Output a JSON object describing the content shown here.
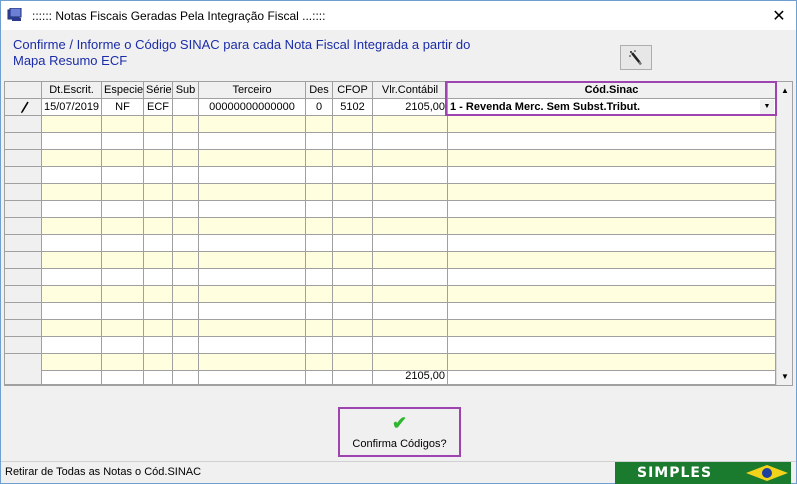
{
  "window": {
    "title": ":::::: Notas Fiscais Geradas Pela Integração Fiscal ...::::",
    "close_glyph": "✕"
  },
  "header": {
    "instruction": "Confirme / Informe o Código SINAC para cada Nota Fiscal Integrada a partir do Mapa Resumo ECF",
    "tool_icon": "wand-icon"
  },
  "grid": {
    "columns": [
      "",
      "Dt.Escrit.",
      "Especie",
      "Série",
      "Sub",
      "Terceiro",
      "Des",
      "CFOP",
      "Vlr.Contábil",
      "Cód.Sinac"
    ],
    "rows": [
      {
        "indicator": "pencil-icon",
        "dt_escrit": "15/07/2019",
        "especie": "NF",
        "serie": "ECF",
        "sub": "",
        "terceiro": "00000000000000",
        "des": "0",
        "cfop": "5102",
        "vlr_contabil": "2105,00",
        "cod_sinac": "1 - Revenda Merc. Sem Subst.Tribut."
      }
    ],
    "empty_rows": 15,
    "total_vlr_contabil": "2105,00"
  },
  "confirm": {
    "label": "Confirma Códigos?",
    "icon": "check-icon"
  },
  "status": {
    "text": "Retirar de Todas as Notas o Cód.SINAC"
  },
  "logo": {
    "text": "SIMPLES"
  },
  "colors": {
    "header_text": "#1b2ca8",
    "alt_row": "#ffffe0",
    "highlight": "#9e44b0",
    "check": "#2fb52f",
    "logo_bg": "#1a7a2e"
  }
}
